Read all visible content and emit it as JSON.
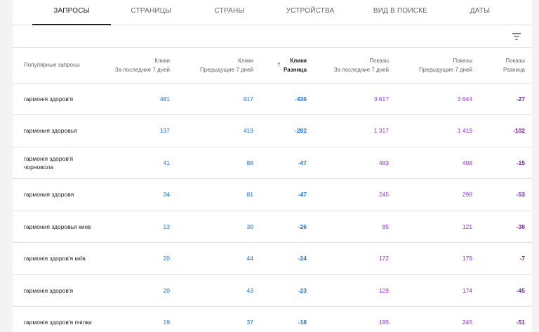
{
  "tabs": [
    {
      "label": "ЗАПРОСЫ",
      "active": true
    },
    {
      "label": "СТРАНИЦЫ",
      "active": false
    },
    {
      "label": "СТРАНЫ",
      "active": false
    },
    {
      "label": "УСТРОЙСТВА",
      "active": false
    },
    {
      "label": "ВИД В ПОИСКЕ",
      "active": false
    },
    {
      "label": "ДАТЫ",
      "active": false
    }
  ],
  "table": {
    "headers": {
      "query": "Популярные запросы",
      "clicks_last": {
        "line1": "Клики",
        "line2": "За последние 7 дней"
      },
      "clicks_prev": {
        "line1": "Клики",
        "line2": "Предыдущие 7 дней"
      },
      "clicks_diff": {
        "line1": "Клики",
        "line2": "Разница"
      },
      "impr_last": {
        "line1": "Показы",
        "line2": "За последние 7 дней"
      },
      "impr_prev": {
        "line1": "Показы",
        "line2": "Предыдущие 7 дней"
      },
      "impr_diff": {
        "line1": "Показы",
        "line2": "Разница"
      }
    },
    "sort_icon": "arrow-up-icon",
    "rows": [
      {
        "query": "гармонія здоров'я",
        "clicks_last": "481",
        "clicks_prev": "917",
        "clicks_diff": "-436",
        "impr_last": "3 617",
        "impr_prev": "3 644",
        "impr_diff": "-27"
      },
      {
        "query": "гармония здоровья",
        "clicks_last": "137",
        "clicks_prev": "419",
        "clicks_diff": "-282",
        "impr_last": "1 317",
        "impr_prev": "1 419",
        "impr_diff": "-102"
      },
      {
        "query": "гармонія здоров'я чорновола",
        "clicks_last": "41",
        "clicks_prev": "88",
        "clicks_diff": "-47",
        "impr_last": "483",
        "impr_prev": "498",
        "impr_diff": "-15"
      },
      {
        "query": "гармония здоровя",
        "clicks_last": "34",
        "clicks_prev": "81",
        "clicks_diff": "-47",
        "impr_last": "245",
        "impr_prev": "298",
        "impr_diff": "-53"
      },
      {
        "query": "гармония здоровья киев",
        "clicks_last": "13",
        "clicks_prev": "39",
        "clicks_diff": "-26",
        "impr_last": "85",
        "impr_prev": "121",
        "impr_diff": "-36"
      },
      {
        "query": "гармонія здоров'я київ",
        "clicks_last": "20",
        "clicks_prev": "44",
        "clicks_diff": "-24",
        "impr_last": "172",
        "impr_prev": "179",
        "impr_diff": "-7"
      },
      {
        "query": "гармонія здоров'я",
        "clicks_last": "20",
        "clicks_prev": "43",
        "clicks_diff": "-23",
        "impr_last": "129",
        "impr_prev": "174",
        "impr_diff": "-45"
      },
      {
        "query": "гармонія здоров'я пчілки",
        "clicks_last": "19",
        "clicks_prev": "37",
        "clicks_diff": "-18",
        "impr_last": "195",
        "impr_prev": "246",
        "impr_diff": "-51"
      }
    ]
  },
  "filter_icon": "filter-icon",
  "colors": {
    "clicks": "#1a73e8",
    "impressions": "#9334e6",
    "impressions_diff": "#7b1fa2"
  }
}
